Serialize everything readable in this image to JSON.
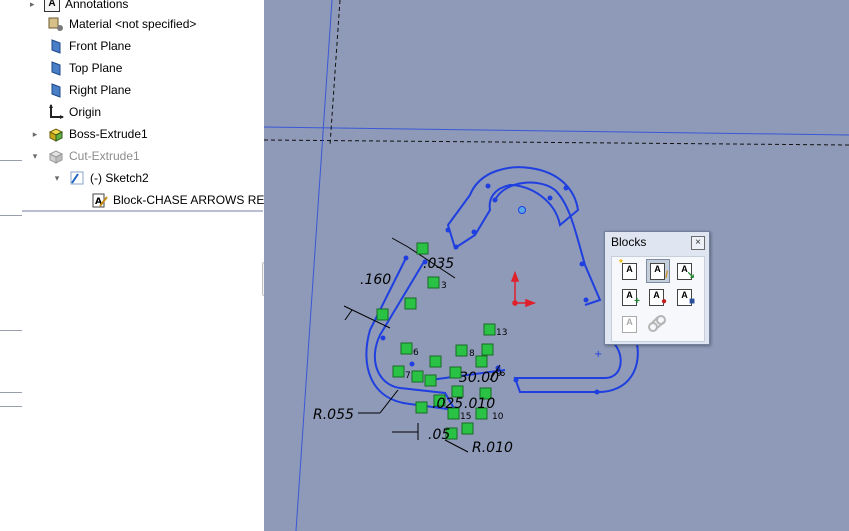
{
  "tree": {
    "items": [
      {
        "label": "Annotations",
        "icon": "annotations-icon"
      },
      {
        "label": "Material <not specified>",
        "icon": "material-icon"
      },
      {
        "label": "Front Plane",
        "icon": "plane-icon"
      },
      {
        "label": "Top Plane",
        "icon": "plane-icon"
      },
      {
        "label": "Right Plane",
        "icon": "plane-icon"
      },
      {
        "label": "Origin",
        "icon": "origin-icon"
      },
      {
        "label": "Boss-Extrude1",
        "icon": "boss-extrude-icon"
      },
      {
        "label": "Cut-Extrude1",
        "icon": "cut-extrude-icon"
      },
      {
        "label": "(-) Sketch2",
        "icon": "sketch-icon"
      },
      {
        "label": "Block-CHASE ARROWS REV",
        "icon": "block-icon"
      }
    ]
  },
  "dimensions": {
    "d1": ".160",
    "d2": ".035",
    "d3": "R.055",
    "d4": ".025",
    "d5": ".010",
    "d6": "30.00°",
    "d7": "R.010",
    "d8": ".05"
  },
  "relation_numbers": [
    "3",
    "6",
    "7",
    "8",
    "9",
    "10",
    "13",
    "15"
  ],
  "blocks_panel": {
    "title": "Blocks",
    "close": "×",
    "buttons": [
      {
        "name": "insert-block-icon",
        "glyph": "A"
      },
      {
        "name": "edit-block-icon",
        "glyph": "A"
      },
      {
        "name": "make-block-icon",
        "glyph": "A"
      },
      {
        "name": "add-remove-entities-icon",
        "glyph": "A"
      },
      {
        "name": "rebuild-block-icon",
        "glyph": "A"
      },
      {
        "name": "save-block-icon",
        "glyph": "A"
      },
      {
        "name": "explode-block-icon",
        "glyph": "A"
      },
      {
        "name": "belt-chain-icon",
        "glyph": ""
      }
    ]
  },
  "colors": {
    "canvas": "#8e9ab8",
    "sketch": "#1f3fe0",
    "relation": "#29c244",
    "origin": "#e0202a"
  }
}
